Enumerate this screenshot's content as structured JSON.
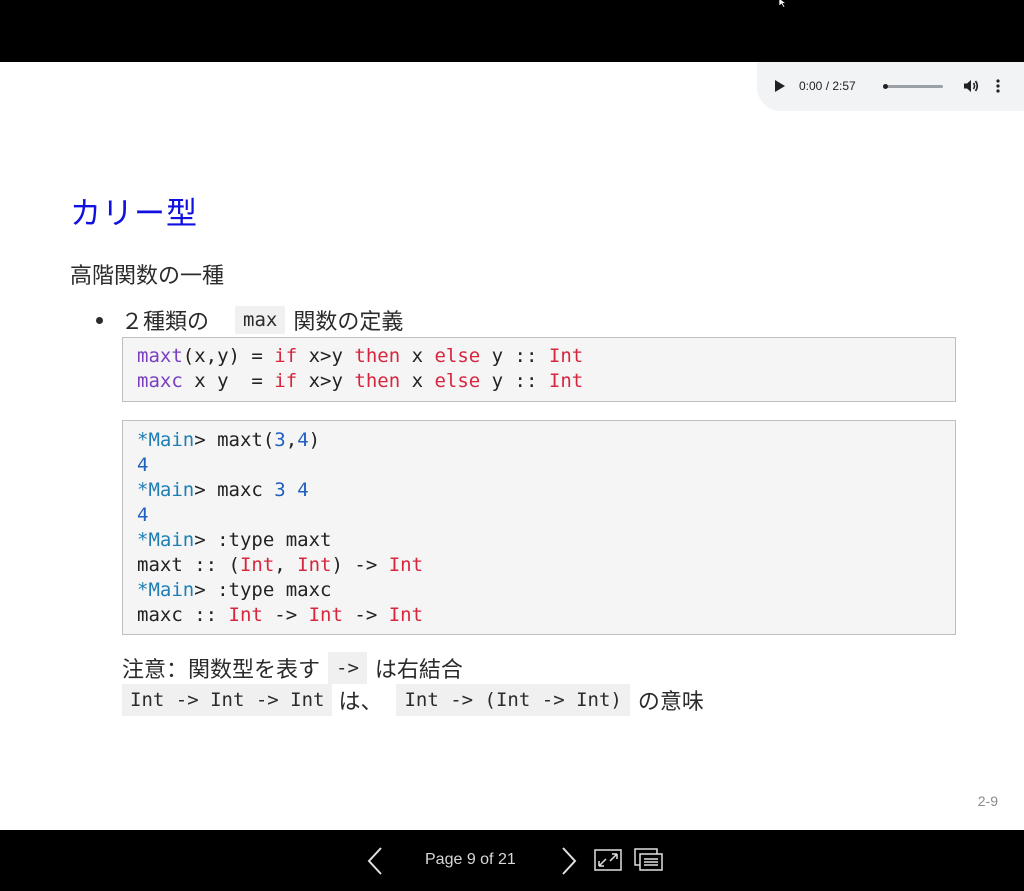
{
  "audio": {
    "time": "0:00 / 2:57",
    "progress_fraction": 0.0
  },
  "slide": {
    "title": "カリー型",
    "lead": "高階関数の一種",
    "bullet": {
      "prefix": "２種類の",
      "code": "max",
      "suffix": "関数の定義"
    },
    "code1": [
      [
        {
          "c": "fn",
          "t": "maxt"
        },
        {
          "c": "",
          "t": "(x,y) = "
        },
        {
          "c": "kw",
          "t": "if"
        },
        {
          "c": "",
          "t": " x>y "
        },
        {
          "c": "kw",
          "t": "then"
        },
        {
          "c": "",
          "t": " x "
        },
        {
          "c": "kw",
          "t": "else"
        },
        {
          "c": "",
          "t": " y :: "
        },
        {
          "c": "ty",
          "t": "Int"
        }
      ],
      [
        {
          "c": "fn",
          "t": "maxc"
        },
        {
          "c": "",
          "t": " x y  = "
        },
        {
          "c": "kw",
          "t": "if"
        },
        {
          "c": "",
          "t": " x>y "
        },
        {
          "c": "kw",
          "t": "then"
        },
        {
          "c": "",
          "t": " x "
        },
        {
          "c": "kw",
          "t": "else"
        },
        {
          "c": "",
          "t": " y :: "
        },
        {
          "c": "ty",
          "t": "Int"
        }
      ]
    ],
    "code2": [
      [
        {
          "c": "pr",
          "t": "*Main"
        },
        {
          "c": "",
          "t": "> maxt("
        },
        {
          "c": "num",
          "t": "3"
        },
        {
          "c": "",
          "t": ","
        },
        {
          "c": "num",
          "t": "4"
        },
        {
          "c": "",
          "t": ")"
        }
      ],
      [
        {
          "c": "num",
          "t": "4"
        }
      ],
      [
        {
          "c": "pr",
          "t": "*Main"
        },
        {
          "c": "",
          "t": "> maxc "
        },
        {
          "c": "num",
          "t": "3"
        },
        {
          "c": "",
          "t": " "
        },
        {
          "c": "num",
          "t": "4"
        }
      ],
      [
        {
          "c": "num",
          "t": "4"
        }
      ],
      [
        {
          "c": "pr",
          "t": "*Main"
        },
        {
          "c": "",
          "t": "> :type maxt"
        }
      ],
      [
        {
          "c": "",
          "t": "maxt :: ("
        },
        {
          "c": "ty",
          "t": "Int"
        },
        {
          "c": "",
          "t": ", "
        },
        {
          "c": "ty",
          "t": "Int"
        },
        {
          "c": "",
          "t": ") -> "
        },
        {
          "c": "ty",
          "t": "Int"
        }
      ],
      [
        {
          "c": "pr",
          "t": "*Main"
        },
        {
          "c": "",
          "t": "> :type maxc"
        }
      ],
      [
        {
          "c": "",
          "t": "maxc :: "
        },
        {
          "c": "ty",
          "t": "Int"
        },
        {
          "c": "",
          "t": " -> "
        },
        {
          "c": "ty",
          "t": "Int"
        },
        {
          "c": "",
          "t": " -> "
        },
        {
          "c": "ty",
          "t": "Int"
        }
      ]
    ],
    "note1": {
      "prefix": "注意：関数型を表す",
      "code": "->",
      "suffix": "は右結合"
    },
    "note2": {
      "code1": "Int -> Int -> Int",
      "mid": "は、",
      "code2": "Int -> (Int -> Int)",
      "suffix": "の意味"
    },
    "page_label": "2-9"
  },
  "nav": {
    "page_text": "Page 9 of 21"
  },
  "colors": {
    "title": "#1010e0",
    "keyword": "#d7263d",
    "function": "#7a3fc0",
    "prompt": "#1f7fb4",
    "number": "#1f5fbf"
  }
}
